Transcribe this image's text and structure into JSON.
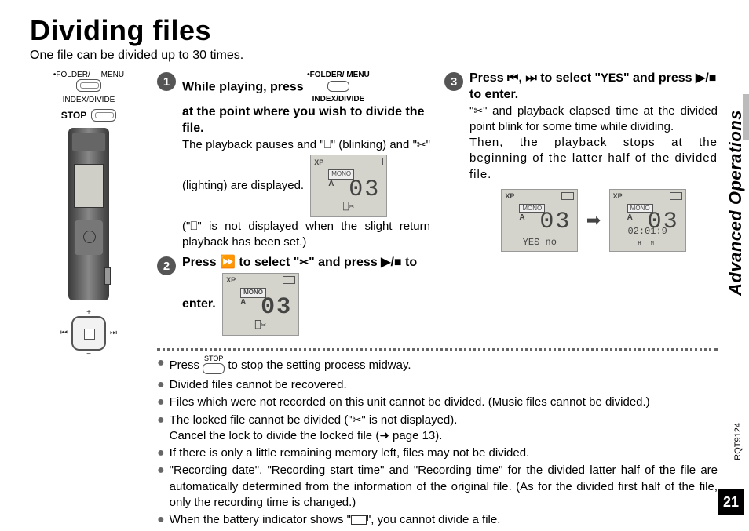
{
  "title": "Dividing files",
  "subtitle": "One file can be divided up to 30 times.",
  "section_label": "Advanced Operations",
  "doc_code": "RQT9124",
  "page_number": "21",
  "left": {
    "label_folder": "•FOLDER/",
    "label_menu": "MENU",
    "label_index": "INDEX/DIVIDE",
    "label_stop": "STOP"
  },
  "button_labels": {
    "stop_inline": "STOP"
  },
  "symbols": {
    "skip_back": "⏮",
    "skip_fwd": "⏭",
    "ffwd": "⏩",
    "play_stop": "▶/■",
    "scissors": "✂",
    "yes": "YES",
    "dividemark": "⎕",
    "arrow": "➡"
  },
  "steps": {
    "1": {
      "num": "1",
      "head_a": "While playing, press",
      "mini_top": "•FOLDER/   MENU",
      "mini_bot": "INDEX/DIVIDE",
      "head_b": "at the point where you wish to divide the file.",
      "body_a": "The playback pauses and \"",
      "body_b": "\" (blinking) and \"",
      "body_c": "\" (lighting) are displayed.",
      "body_d": "(\"",
      "body_e": "\" is not displayed when the slight return playback has been set.)"
    },
    "2": {
      "num": "2",
      "head_a": "Press ",
      "head_b": " to select \"",
      "head_c": "\" and press ",
      "head_d": " to enter."
    },
    "3": {
      "num": "3",
      "head_a": "Press ",
      "head_b": ", ",
      "head_c": " to select \"",
      "head_d": "\" and press ",
      "head_e": " to enter.",
      "body_a": "\"",
      "body_b": "\" and playback elapsed time at the divided point blink for some time while dividing.",
      "body_c": "Then, the playback stops at the beginning of the latter half of the divided file."
    }
  },
  "lcd": {
    "xp": "XP",
    "mono": "MONO",
    "a": "A",
    "num03": "03",
    "yes_no": "YES  no",
    "time": "02:01:9",
    "hm": "H     M"
  },
  "notes": {
    "1a": "Press ",
    "1b": " to stop the setting process midway.",
    "2": "Divided files cannot be recovered.",
    "3": "Files which were not recorded on this unit cannot be divided. (Music files cannot be divided.)",
    "4a": "The locked file cannot be divided (\"",
    "4b": "\" is not displayed).",
    "4c": "Cancel the lock to divide the locked file (➜ page 13).",
    "5": "If there is only a little remaining memory left, files may not be divided.",
    "6": "\"Recording date\", \"Recording start time\" and \"Recording time\" for the divided latter half of the file are automatically determined from the information of the original file. (As for the divided first half of the file, only the recording time is changed.)",
    "7a": "When the battery indicator shows \"",
    "7b": "\", you cannot divide a file."
  }
}
